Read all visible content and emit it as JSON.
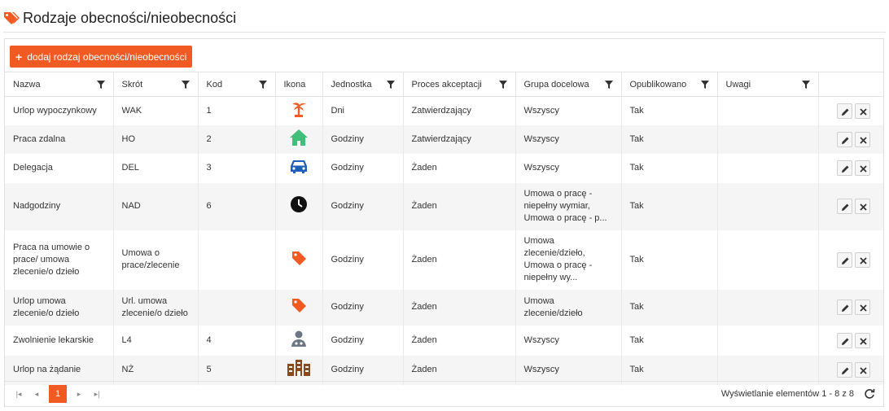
{
  "page": {
    "title": "Rodzaje obecności/nieobecności",
    "add_button": "dodaj rodzaj obecności/nieobecności",
    "accent": "#f15a22"
  },
  "columns": [
    "Nazwa",
    "Skrót",
    "Kod",
    "Ikona",
    "Jednostka",
    "Proces akceptacji",
    "Grupa docelowa",
    "Opublikowano",
    "Uwagi"
  ],
  "rows": [
    {
      "name": "Urlop wypoczynkowy",
      "short": "WAK",
      "code": "1",
      "icon": "palm-tree-icon",
      "unit": "Dni",
      "process": "Zatwierdzający",
      "group": "Wszyscy",
      "published": "Tak",
      "notes": ""
    },
    {
      "name": "Praca zdalna",
      "short": "HO",
      "code": "2",
      "icon": "home-icon",
      "unit": "Godziny",
      "process": "Zatwierdzający",
      "group": "Wszyscy",
      "published": "Tak",
      "notes": ""
    },
    {
      "name": "Delegacja",
      "short": "DEL",
      "code": "3",
      "icon": "car-icon",
      "unit": "Godziny",
      "process": "Żaden",
      "group": "Wszyscy",
      "published": "Tak",
      "notes": ""
    },
    {
      "name": "Nadgodziny",
      "short": "NAD",
      "code": "6",
      "icon": "clock-icon",
      "unit": "Godziny",
      "process": "Żaden",
      "group": "Umowa o pracę - niepełny wymiar, Umowa o pracę - p...",
      "published": "Tak",
      "notes": ""
    },
    {
      "name": "Praca na umowie o prace/ umowa zlecenie/o dzieło",
      "short": "Umowa o prace/zlecenie",
      "code": "",
      "icon": "tag-icon",
      "unit": "Godziny",
      "process": "Żaden",
      "group": "Umowa zlecenie/dzieło, Umowa o pracę - niepełny wy...",
      "published": "Tak",
      "notes": ""
    },
    {
      "name": "Urlop umowa zlecenie/o dzieło",
      "short": "Url. umowa zlecenie/o dzieło",
      "code": "",
      "icon": "tag-icon",
      "unit": "Godziny",
      "process": "Żaden",
      "group": "Umowa zlecenie/dzieło",
      "published": "Tak",
      "notes": ""
    },
    {
      "name": "Zwolnienie lekarskie",
      "short": "L4",
      "code": "4",
      "icon": "doctor-icon",
      "unit": "Godziny",
      "process": "Żaden",
      "group": "Wszyscy",
      "published": "Tak",
      "notes": ""
    },
    {
      "name": "Urlop na żądanie",
      "short": "NŻ",
      "code": "5",
      "icon": "hotel-icon",
      "unit": "Godziny",
      "process": "Żaden",
      "group": "Wszyscy",
      "published": "Tak",
      "notes": ""
    }
  ],
  "pager": {
    "current_page": "1",
    "info": "Wyświetlanie elementów 1 - 8 z 8"
  }
}
